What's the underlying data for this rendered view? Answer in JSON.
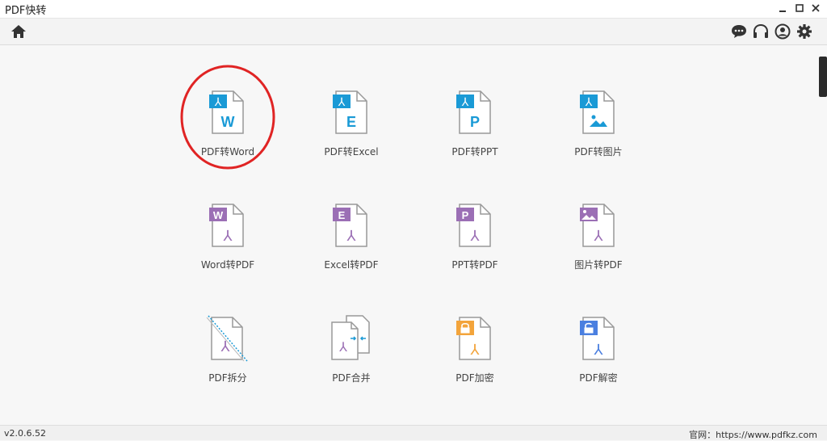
{
  "window": {
    "title": "PDF快转"
  },
  "toolbar": {
    "home_icon": "home-icon",
    "right_icons": [
      "chat-icon",
      "headset-icon",
      "user-icon",
      "gear-icon"
    ]
  },
  "tiles": [
    {
      "label": "PDF转Word",
      "badge": "W",
      "badge_color": "#1a9ad6",
      "kind": "from-pdf"
    },
    {
      "label": "PDF转Excel",
      "badge": "E",
      "badge_color": "#1a9ad6",
      "kind": "from-pdf"
    },
    {
      "label": "PDF转PPT",
      "badge": "P",
      "badge_color": "#1a9ad6",
      "kind": "from-pdf"
    },
    {
      "label": "PDF转图片",
      "badge": "image",
      "badge_color": "#1a9ad6",
      "kind": "from-pdf"
    },
    {
      "label": "Word转PDF",
      "badge": "W",
      "badge_color": "#9b6fb5",
      "kind": "to-pdf"
    },
    {
      "label": "Excel转PDF",
      "badge": "E",
      "badge_color": "#9b6fb5",
      "kind": "to-pdf"
    },
    {
      "label": "PPT转PDF",
      "badge": "P",
      "badge_color": "#9b6fb5",
      "kind": "to-pdf"
    },
    {
      "label": "图片转PDF",
      "badge": "image",
      "badge_color": "#9b6fb5",
      "kind": "to-pdf"
    },
    {
      "label": "PDF拆分",
      "badge": "split",
      "badge_color": "#1a9ad6",
      "kind": "tool"
    },
    {
      "label": "PDF合并",
      "badge": "merge",
      "badge_color": "#1a9ad6",
      "kind": "tool"
    },
    {
      "label": "PDF加密",
      "badge": "lock",
      "badge_color": "#f3a43b",
      "kind": "tool"
    },
    {
      "label": "PDF解密",
      "badge": "unlock",
      "badge_color": "#4a7fe0",
      "kind": "tool"
    }
  ],
  "status": {
    "version": "v2.0.6.52",
    "site": "官网：https://www.pdfkz.com"
  },
  "colors": {
    "highlight": "#e02424",
    "pdf_symbol": "#9b6fb5"
  }
}
